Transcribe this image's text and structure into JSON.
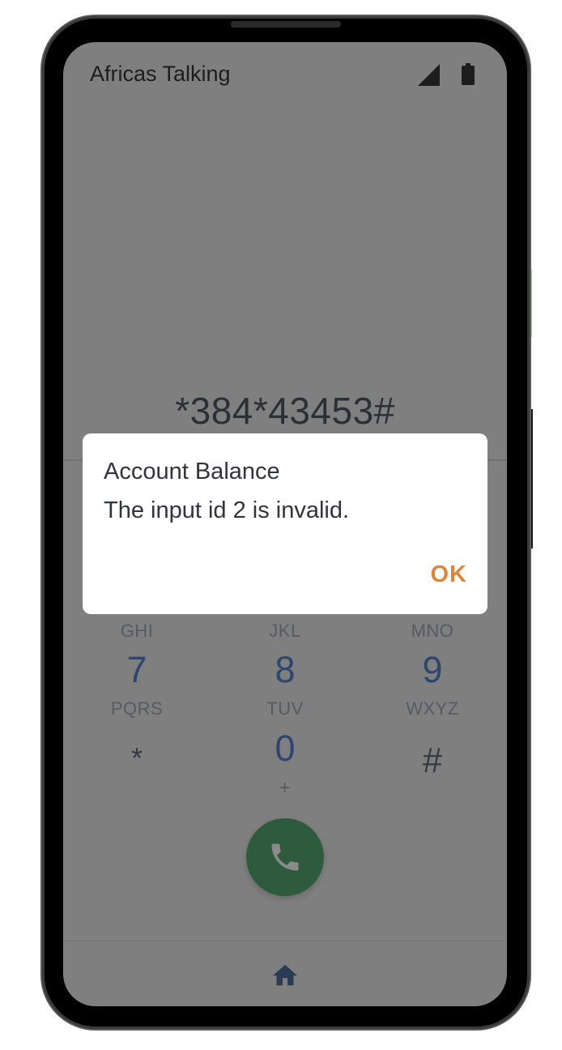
{
  "status_bar": {
    "carrier": "Africas Talking",
    "signal_icon": "cell-signal-icon",
    "battery_icon": "battery-icon"
  },
  "dialer": {
    "number": "*384*43453#",
    "keys": [
      {
        "letters_above": "GHI",
        "digit": "7"
      },
      {
        "letters_above": "JKL",
        "digit": "8"
      },
      {
        "letters_above": "MNO",
        "digit": "9"
      },
      {
        "letters_above": "PQRS",
        "digit": "*"
      },
      {
        "letters_above": "TUV",
        "digit": "0"
      },
      {
        "letters_above": "WXYZ",
        "digit": "#"
      }
    ],
    "zero_sublabel": "+",
    "call_icon": "phone-icon"
  },
  "nav": {
    "home_icon": "home-icon"
  },
  "dialog": {
    "title": "Account Balance",
    "message": "The input id 2 is invalid.",
    "ok_label": "OK"
  },
  "colors": {
    "overlay": "#7f7f7f",
    "accent_ok": "#d8883c",
    "call_button": "#2e5a3d",
    "digit": "#2d4670"
  }
}
